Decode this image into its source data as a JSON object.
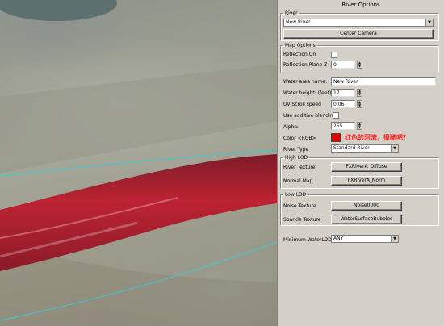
{
  "window": {
    "title": "River Options"
  },
  "river_group": {
    "label": "River",
    "selected_river": "New River",
    "center_camera_label": "Center Camera"
  },
  "map_options": {
    "label": "Map Options",
    "reflection_on_label": "Reflection On",
    "reflection_on_checked": false,
    "reflection_plane_z_label": "Reflection Plane Z",
    "reflection_plane_z_value": "0"
  },
  "water": {
    "area_name_label": "Water area name:",
    "area_name_value": "New River",
    "height_label": "Water height: (feet):",
    "height_value": "17",
    "uv_scroll_label": "UV Scroll speed",
    "uv_scroll_value": "0.06",
    "additive_label": "Use additive blending",
    "additive_checked": false,
    "alpha_label": "Alpha:",
    "alpha_value": "255",
    "color_label": "Color <RGB>",
    "color_value": "#e00000",
    "annotation": "红色的河流，很酷吧？",
    "river_type_label": "River Type",
    "river_type_value": "Standard River"
  },
  "high_lod": {
    "label": "High LOD",
    "river_texture_label": "River Texture",
    "river_texture_value": "FXRiverA_Diffuse",
    "normal_map_label": "Normal Map",
    "normal_map_value": "FXRiverA_Norm"
  },
  "low_lod": {
    "label": "Low LOD",
    "noise_texture_label": "Noise Texture",
    "noise_texture_value": "Noise0000",
    "sparkle_texture_label": "Sparkle Texture",
    "sparkle_texture_value": "WaterSurfaceBubbles"
  },
  "minimum_water_lod": {
    "label": "Minimum WaterLOD",
    "value": "ANY"
  },
  "colors": {
    "panel_bg": "#d4d0c8",
    "river_red": "#b01020",
    "guide_line": "#3ec8d8",
    "annotation_red": "#ff1e1e"
  }
}
